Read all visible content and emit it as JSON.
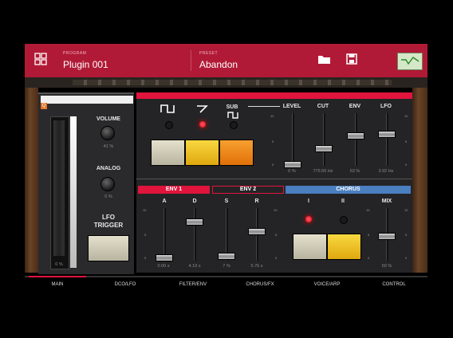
{
  "header": {
    "program_label": "PROGRAM",
    "program_value": "Plugin 001",
    "preset_label": "PRESET",
    "preset_value": "Abandon"
  },
  "left": {
    "volume_label": "VOLUME",
    "volume_value": "41 %",
    "analog_label": "ANALOG",
    "analog_value": "0 %",
    "lfo_trigger_label": "LFO TRIGGER",
    "bend_value": "0 %"
  },
  "dco": {
    "sub_label": "SUB",
    "level_label": "LEVEL",
    "cut_label": "CUT",
    "env_label": "ENV",
    "lfo_label": "LFO",
    "level_value": "0 %",
    "cut_value": "775.55 Hz",
    "env_value": "63 %",
    "lfo_value": "3.92 Hz",
    "scale_top": "10",
    "scale_mid": "5",
    "scale_bottom": "0"
  },
  "env1": {
    "title": "ENV 1",
    "a_label": "A",
    "d_label": "D",
    "a_value": "0.00 s",
    "d_value": "4.19 s"
  },
  "env2": {
    "title": "ENV 2",
    "s_label": "S",
    "r_label": "R",
    "s_value": "7 %",
    "r_value": "5.76 s"
  },
  "chorus": {
    "title": "CHORUS",
    "i_label": "I",
    "ii_label": "II",
    "mix_label": "MIX",
    "mix_value": "50 %"
  },
  "tabs": [
    "MAIN",
    "DCO/LFO",
    "FILTER/ENV",
    "CHORUS/FX",
    "VOICE/ARP",
    "CONTROL"
  ],
  "colors": {
    "header": "#b11a36",
    "accent_red": "#e0143c",
    "chorus_blue": "#4a7fc0",
    "button_cream": "#d8d4c0",
    "button_yellow": "#f2c21a",
    "button_orange": "#f08a10"
  }
}
